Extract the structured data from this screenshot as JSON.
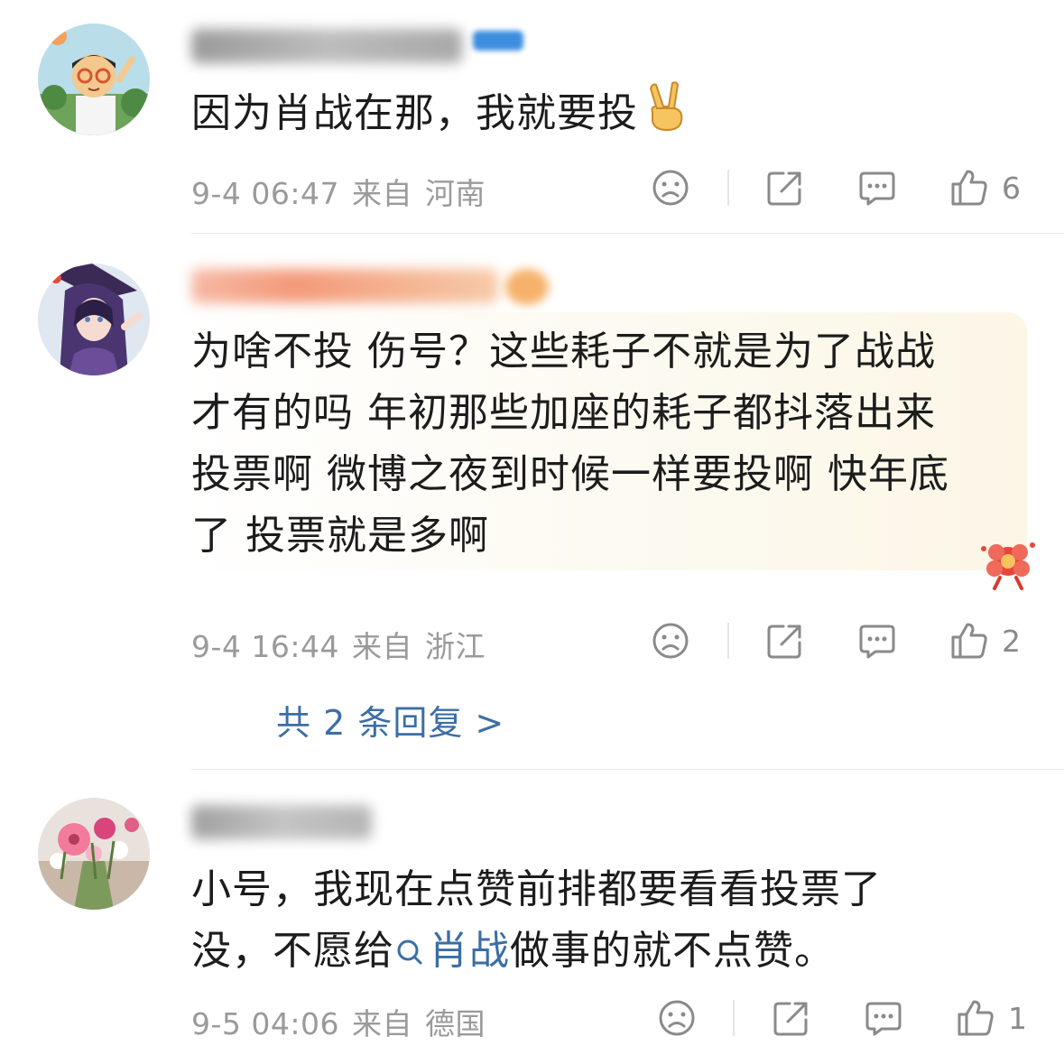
{
  "comments": [
    {
      "text_lines": [
        "因为肖战在那，我就要投"
      ],
      "emoji": "victory-hand",
      "date": "9-4 06:47",
      "from_label": "来自",
      "location": "河南",
      "likes": "6"
    },
    {
      "text_lines": [
        "为啥不投 伤号？这些耗子不就是为了战战",
        "才有的吗 年初那些加座的耗子都抖落出来",
        "投票啊 微博之夜到时候一样要投啊 快年底",
        "了 投票就是多啊"
      ],
      "date": "9-4 16:44",
      "from_label": "来自",
      "location": "浙江",
      "likes": "2",
      "replies_link": "共 2 条回复 >"
    },
    {
      "text_line1": "小号，我现在点赞前排都要看看投票了",
      "text_line2_before": "没，不愿给",
      "search_link": "肖战",
      "text_line2_after": "做事的就不点赞。",
      "date": "9-5 04:06",
      "from_label": "来自",
      "location": "德国",
      "likes": "1"
    }
  ],
  "colors": {
    "text": "#1c1c1c",
    "meta": "#9a9a9a",
    "link": "#3c6ea5",
    "bubble": "#fbf6e6"
  },
  "icons": [
    "sad-face-icon",
    "share-icon",
    "comment-icon",
    "thumbs-up-icon",
    "search-icon",
    "victory-hand-emoji",
    "flower-sticker-icon"
  ]
}
